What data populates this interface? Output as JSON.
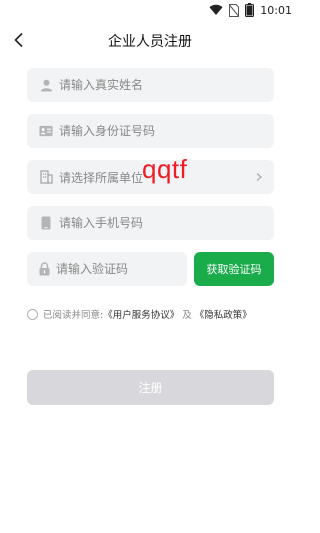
{
  "status_bar": {
    "time": "10:01"
  },
  "nav": {
    "title": "企业人员注册"
  },
  "form": {
    "name_placeholder": "请输入真实姓名",
    "id_placeholder": "请输入身份证号码",
    "unit_placeholder": "请选择所属单位",
    "phone_placeholder": "请输入手机号码",
    "code_placeholder": "请输入验证码",
    "get_code_label": "获取验证码"
  },
  "watermark": "qqtf",
  "agreement": {
    "prefix": "已阅读并同意:",
    "user_agreement": "《用户服务协议》",
    "and": "及",
    "privacy_policy": "《隐私政策》"
  },
  "register_label": "注册",
  "colors": {
    "accent": "#1aab4b",
    "field_bg": "#f2f3f5",
    "disabled": "#d8d8dc",
    "watermark": "#ee1c25"
  }
}
